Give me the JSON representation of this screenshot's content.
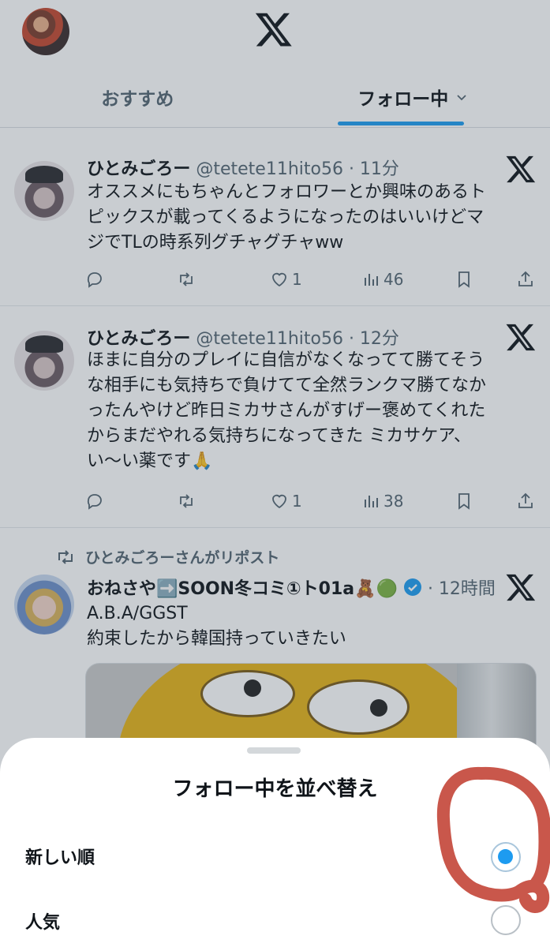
{
  "header": {
    "tabs": [
      {
        "label": "おすすめ",
        "active": false
      },
      {
        "label": "フォロー中",
        "active": true
      }
    ]
  },
  "tweets": [
    {
      "name": "ひとみごろー",
      "handle": "@tetete11hito56 · 11分",
      "text": [
        "オススメにもちゃんとフォロワーとか興味のあるト",
        "ピックスが載ってくるようになったのはいいけどマ",
        "ジでTLの時系列グチャグチャww"
      ],
      "likes": "1",
      "views": "46"
    },
    {
      "name": "ひとみごろー",
      "handle": "@tetete11hito56 · 12分",
      "text": [
        "ほまに自分のプレイに自信がなくなってて勝てそう",
        "な相手にも気持ちで負けてて全然ランクマ勝てなか",
        "ったんやけど昨日ミカサさんがすげー褒めてくれた",
        "からまだやれる気持ちになってきた ミカサケア、",
        "い〜い薬です🙏"
      ],
      "likes": "1",
      "views": "38"
    },
    {
      "retweet_note": "ひとみごろーさんがリポスト",
      "name": "おねさや➡️SOON冬コミ①ト01a🧸🟢",
      "handle": "· 12時間",
      "text": [
        "A.B.A/GGST",
        "約束したから韓国持っていきたい"
      ]
    }
  ],
  "sheet": {
    "title": "フォロー中を並べ替え",
    "options": [
      {
        "label": "新しい順",
        "selected": true
      },
      {
        "label": "人気",
        "selected": false
      }
    ]
  },
  "colors": {
    "accent": "#1d9bf0",
    "annotation": "#c0392b",
    "secondary_text": "#536471"
  }
}
